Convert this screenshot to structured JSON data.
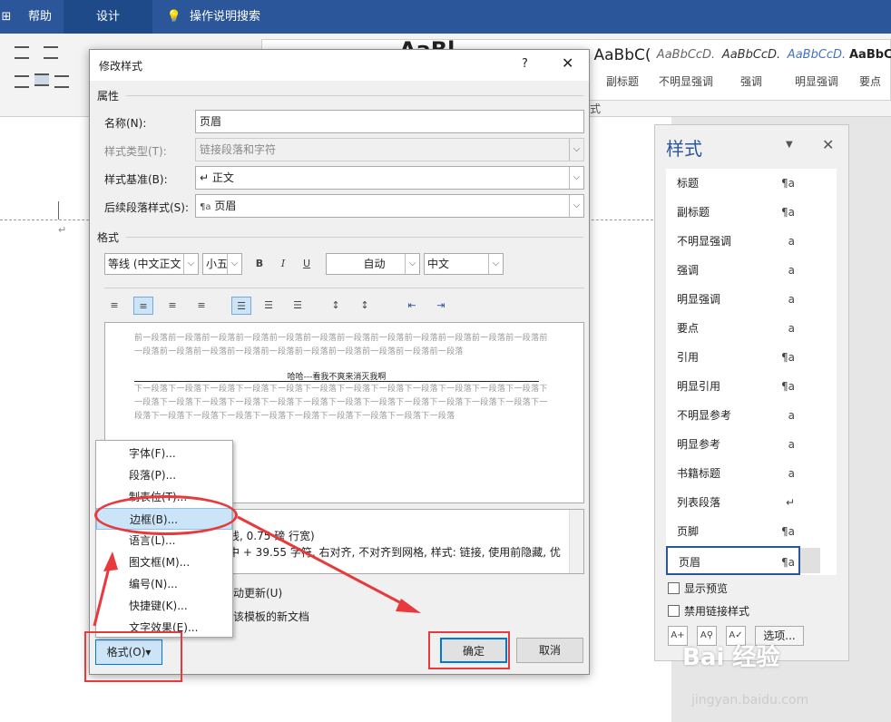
{
  "ribbon_tabs": [
    "帮助",
    "设计",
    "操作说明搜索"
  ],
  "ribbon_styles": [
    {
      "sample": "AaBbC(",
      "name": "副标题"
    },
    {
      "sample": "AaBbCcD.",
      "name": "不明显强调"
    },
    {
      "sample": "AaBbCcD.",
      "name": "强调"
    },
    {
      "sample": "AaBbCcD.",
      "name": "明显强调"
    },
    {
      "sample": "AaBbC",
      "name": "要点"
    }
  ],
  "ribbon_sample_partial": "AaBl",
  "ribbon_group_label": "式",
  "dialog": {
    "title": "修改样式",
    "help": "?",
    "section_props": "属性",
    "name_label": "名称(N):",
    "name_value": "页眉",
    "type_label": "样式类型(T):",
    "type_value": "链接段落和字符",
    "base_label": "样式基准(B):",
    "base_value": "↵ 正文",
    "next_label": "后续段落样式(S):",
    "next_value": "页眉",
    "next_icon": "¶a",
    "section_format": "格式",
    "font": "等线 (中文正文",
    "size": "小五",
    "bold": "B",
    "italic": "I",
    "underline": "U",
    "color": "自动",
    "lang": "中文",
    "preview_prev": "前一段落前一段落前一段落前一段落前一段落前一段落前一段落前一段落前一段落前一段落前一段落前一段落前一段落前一段落前一段落前一段落前一段落前一段落前一段落前一段落前一段落前一段落",
    "preview_text": "哈哈---看我不爽来消灭我啊",
    "preview_next": "下一段落下一段落下一段落下一段落下一段落下一段落下一段落下一段落下一段落下一段落下一段落下一段落下一段落下一段落下一段落下一段落下一段落下一段落下一段落下一段落下一段落下一段落下一段落下一段落下一段落下一段落下一段落下一段落下一段落下一段落下一段落下一段落下一段落下一段落",
    "desc_line1": "线, 0.75 磅 行宽)",
    "desc_line2": "中 + 39.55 字符, 右对齐, 不对齐到网格, 样式: 链接, 使用前隐藏, 优",
    "auto_update": "动更新(U)",
    "template": "该模板的新文档",
    "format_btn": "格式(O)▾",
    "ok": "确定",
    "cancel": "取消"
  },
  "format_menu": [
    "字体(F)...",
    "段落(P)...",
    "制表位(T)...",
    "边框(B)...",
    "语言(L)...",
    "图文框(M)...",
    "编号(N)...",
    "快捷键(K)...",
    "文字效果(E)..."
  ],
  "pane": {
    "title": "样式",
    "items": [
      {
        "name": "标题",
        "icon": "¶a"
      },
      {
        "name": "副标题",
        "icon": "¶a"
      },
      {
        "name": "不明显强调",
        "icon": "a"
      },
      {
        "name": "强调",
        "icon": "a"
      },
      {
        "name": "明显强调",
        "icon": "a"
      },
      {
        "name": "要点",
        "icon": "a"
      },
      {
        "name": "引用",
        "icon": "¶a"
      },
      {
        "name": "明显引用",
        "icon": "¶a"
      },
      {
        "name": "不明显参考",
        "icon": "a"
      },
      {
        "name": "明显参考",
        "icon": "a"
      },
      {
        "name": "书籍标题",
        "icon": "a"
      },
      {
        "name": "列表段落",
        "icon": "↵"
      },
      {
        "name": "页脚",
        "icon": "¶a"
      },
      {
        "name": "页眉",
        "icon": "¶a"
      }
    ],
    "show_preview": "显示预览",
    "disable_linked": "禁用链接样式",
    "options": "选项..."
  },
  "watermark": "Bai 经验",
  "watermark_url": "jingyan.baidu.com"
}
